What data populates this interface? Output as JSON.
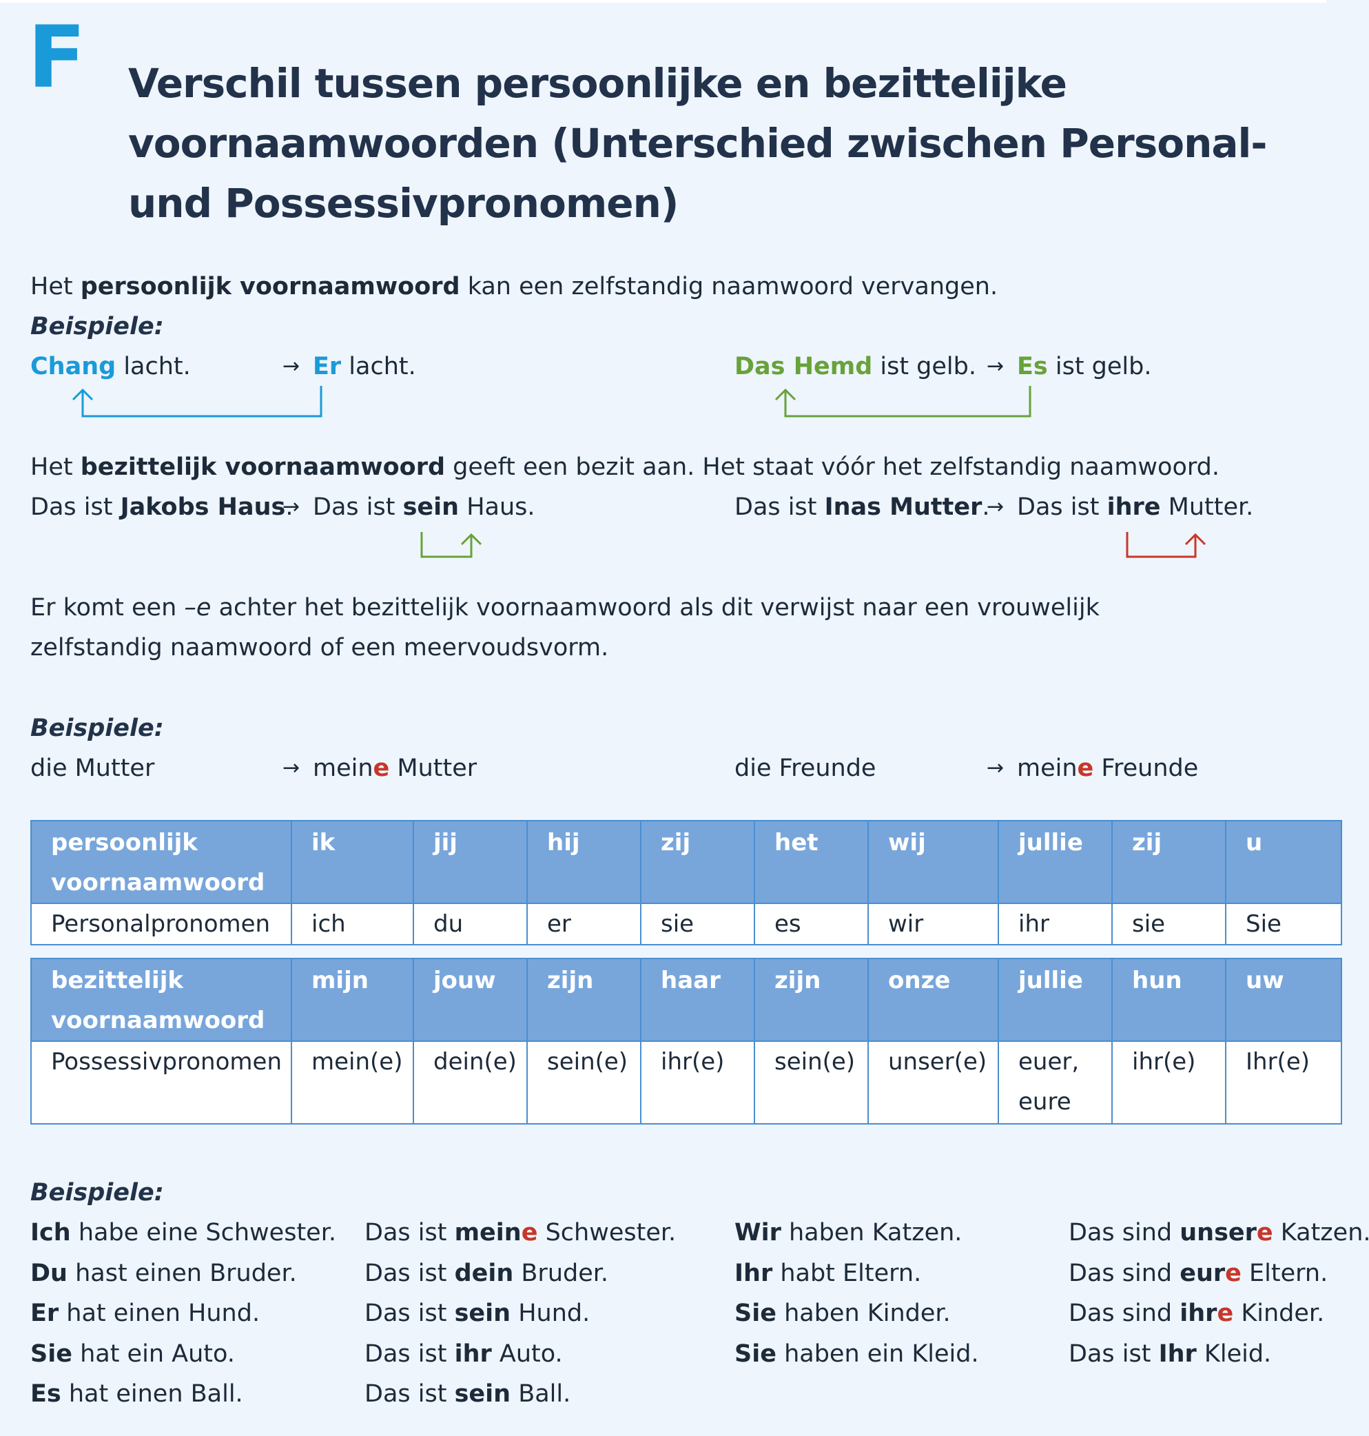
{
  "section_letter": "F",
  "title": "Verschil tussen persoonlijke en bezittelijke voornaamwoorden (Unterschied zwischen Personal- und Possessivpronomen)",
  "arrow": "→",
  "intro1": {
    "pre": "Het ",
    "bold": "persoonlijk voornaamwoord",
    "post": " kan een zelfstandig naamwoord vervangen."
  },
  "beispiele_label": "Beispiele:",
  "ex1": {
    "left": {
      "subject": "Chang",
      "rest": " lacht.",
      "target_subject": "Er",
      "target_rest": " lacht."
    },
    "right": {
      "subject": "Das Hemd",
      "rest": " ist gelb.",
      "target_subject": "Es",
      "target_rest": " ist gelb."
    }
  },
  "intro2": {
    "pre": "Het ",
    "bold": "bezittelijk voornaamwoord",
    "post": " geeft een bezit aan. Het staat vóór het zelfstandig naamwoord."
  },
  "ex2": {
    "left": {
      "pre": "Das ist ",
      "bold": "Jakobs Haus",
      "post": ".",
      "t_pre": "Das ist ",
      "t_bold": "sein",
      "t_post": " Haus."
    },
    "right": {
      "pre": "Das ist ",
      "bold": "Inas Mutter",
      "post": ".",
      "t_pre": "Das ist ",
      "t_bold": "ihre",
      "t_post": " Mutter."
    }
  },
  "rule": {
    "pre": "Er komt een ",
    "ital": "–e",
    "post": " achter het bezittelijk voornaamwoord als dit verwijst naar een vrouwelijk zelfstandig naamwoord of een meervoudsvorm."
  },
  "ex3": {
    "left": {
      "base": "die Mutter",
      "t_stem": "mein",
      "t_end": "e",
      "t_rest": " Mutter"
    },
    "right": {
      "base": "die Freunde",
      "t_stem": "mein",
      "t_end": "e",
      "t_rest": " Freunde"
    }
  },
  "table_personal": {
    "header": [
      "persoonlijk voornaamwoord",
      "ik",
      "jij",
      "hij",
      "zij",
      "het",
      "wij",
      "jullie",
      "zij",
      "u"
    ],
    "row": [
      "Personalpronomen",
      "ich",
      "du",
      "er",
      "sie",
      "es",
      "wir",
      "ihr",
      "sie",
      "Sie"
    ]
  },
  "table_possessive": {
    "header": [
      "bezittelijk voornaamwoord",
      "mijn",
      "jouw",
      "zijn",
      "haar",
      "zijn",
      "onze",
      "jullie",
      "hun",
      "uw"
    ],
    "row": [
      "Possessivpronomen",
      "mein(e)",
      "dein(e)",
      "sein(e)",
      "ihr(e)",
      "sein(e)",
      "unser(e)",
      "euer, eure",
      "ihr(e)",
      "Ihr(e)"
    ]
  },
  "examples": {
    "col1": [
      {
        "b": "Ich",
        "t": " habe eine Schwester."
      },
      {
        "b": "Du",
        "t": " hast einen Bruder."
      },
      {
        "b": "Er",
        "t": " hat einen Hund."
      },
      {
        "b": "Sie",
        "t": " hat ein Auto."
      },
      {
        "b": "Es",
        "t": " hat einen Ball."
      }
    ],
    "col2": [
      {
        "p": "Das ist ",
        "b": "mein",
        "e": "e",
        "t": " Schwester."
      },
      {
        "p": "Das ist ",
        "b": "dein",
        "e": "",
        "t": " Bruder."
      },
      {
        "p": "Das ist ",
        "b": "sein",
        "e": "",
        "t": " Hund."
      },
      {
        "p": "Das ist ",
        "b": "ihr",
        "e": "",
        "t": " Auto."
      },
      {
        "p": "Das ist ",
        "b": "sein",
        "e": "",
        "t": " Ball."
      }
    ],
    "col3": [
      {
        "b": "Wir",
        "t": " haben Katzen."
      },
      {
        "b": "Ihr",
        "t": " habt Eltern."
      },
      {
        "b": "Sie",
        "t": " haben Kinder."
      },
      {
        "b": "Sie",
        "t": " haben ein Kleid."
      }
    ],
    "col4": [
      {
        "p": "Das sind ",
        "b": "unser",
        "e": "e",
        "t": " Katzen."
      },
      {
        "p": "Das sind ",
        "b": "eur",
        "e": "e",
        "t": " Eltern."
      },
      {
        "p": "Das sind ",
        "b": "ihr",
        "e": "e",
        "t": " Kinder."
      },
      {
        "p": "Das ist ",
        "b": "Ihr",
        "e": "",
        "t": " Kleid."
      }
    ]
  },
  "colors": {
    "blue": "#1a9ad8",
    "green": "#68a23a",
    "red": "#c8362a",
    "table_header": "#78a6db",
    "background": "#eef5fc"
  }
}
